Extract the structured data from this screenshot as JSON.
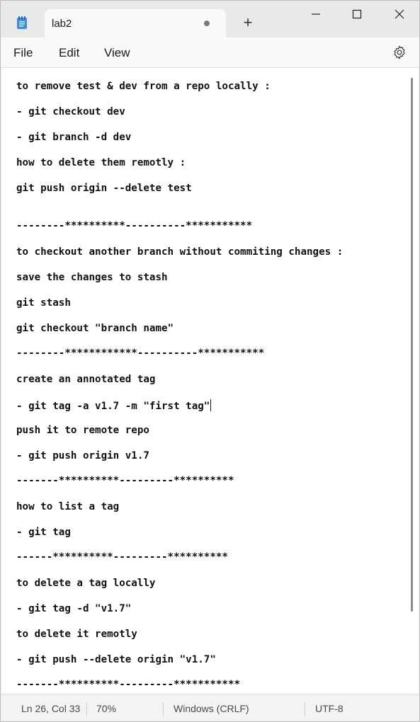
{
  "window": {
    "tab_title": "lab2",
    "new_tab_glyph": "+"
  },
  "menu": {
    "file": "File",
    "edit": "Edit",
    "view": "View"
  },
  "editor": {
    "lines": [
      "to remove test & dev from a repo locally :",
      "- git checkout dev",
      "- git branch -d dev",
      "how to delete them remotly :",
      "git push origin --delete test",
      "--------**********----------***********",
      "to checkout another branch without commiting changes :",
      "save the changes to stash",
      "git stash",
      "git checkout \"branch name\"",
      "--------************----------***********",
      "create an annotated tag",
      "- git tag -a v1.7 -m \"first tag\"",
      "push it to remote repo",
      "- git push origin v1.7",
      "-------**********---------**********",
      "how to list a tag",
      "- git tag",
      "------**********---------**********",
      "to delete a tag locally",
      "- git tag -d \"v1.7\"",
      "to delete it remotly",
      "- git push --delete origin \"v1.7\"",
      "-------**********---------***********"
    ]
  },
  "status": {
    "position": "Ln 26, Col 33",
    "zoom": "70%",
    "line_ending": "Windows (CRLF)",
    "encoding": "UTF-8"
  },
  "icons": {
    "app": "notepad-icon",
    "minimize": "minimize-icon",
    "maximize": "maximize-icon",
    "close": "close-icon",
    "settings": "gear-icon"
  }
}
